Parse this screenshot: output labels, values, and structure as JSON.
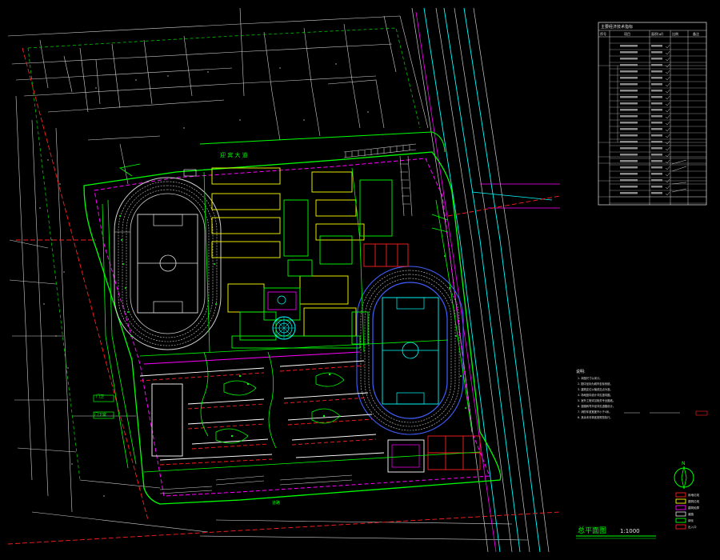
{
  "drawing": {
    "title": "总平面图",
    "scale": "1:1000",
    "road_label": "迎 宾 大 道",
    "colors": {
      "background": "#000000",
      "green": "#00ff00",
      "dark_green": "#00a000",
      "white": "#e6e6e6",
      "magenta": "#ff00ff",
      "yellow": "#ffff00",
      "cyan": "#00ffff",
      "red": "#ff2020",
      "blue": "#4060ff",
      "grey": "#9a9a9a"
    }
  },
  "economic_table": {
    "title": "主要经济技术指标",
    "columns": [
      "序号",
      "项目",
      "面积(㎡)",
      "比例",
      "备注"
    ]
  },
  "notes": {
    "heading": "说明:",
    "lines": [
      "1. 本图尺寸以米计。",
      "2. 图中坐标为城市坐标系统。",
      "3. 建筑定位以轴线交点为准。",
      "4. 场地竖向设计详见竖向图。",
      "5. 室外工程详见相关专业图纸。",
      "6. 道路转弯半径详见道路设计。",
      "7. 消防车道宽度不小于4米。",
      "8. 其余未尽事宜按规范执行。"
    ]
  },
  "legend": {
    "items": [
      "用地红线",
      "建筑红线",
      "建筑轮廓",
      "道路",
      "绿化",
      "出入口"
    ]
  },
  "compass": {
    "label": "N"
  }
}
